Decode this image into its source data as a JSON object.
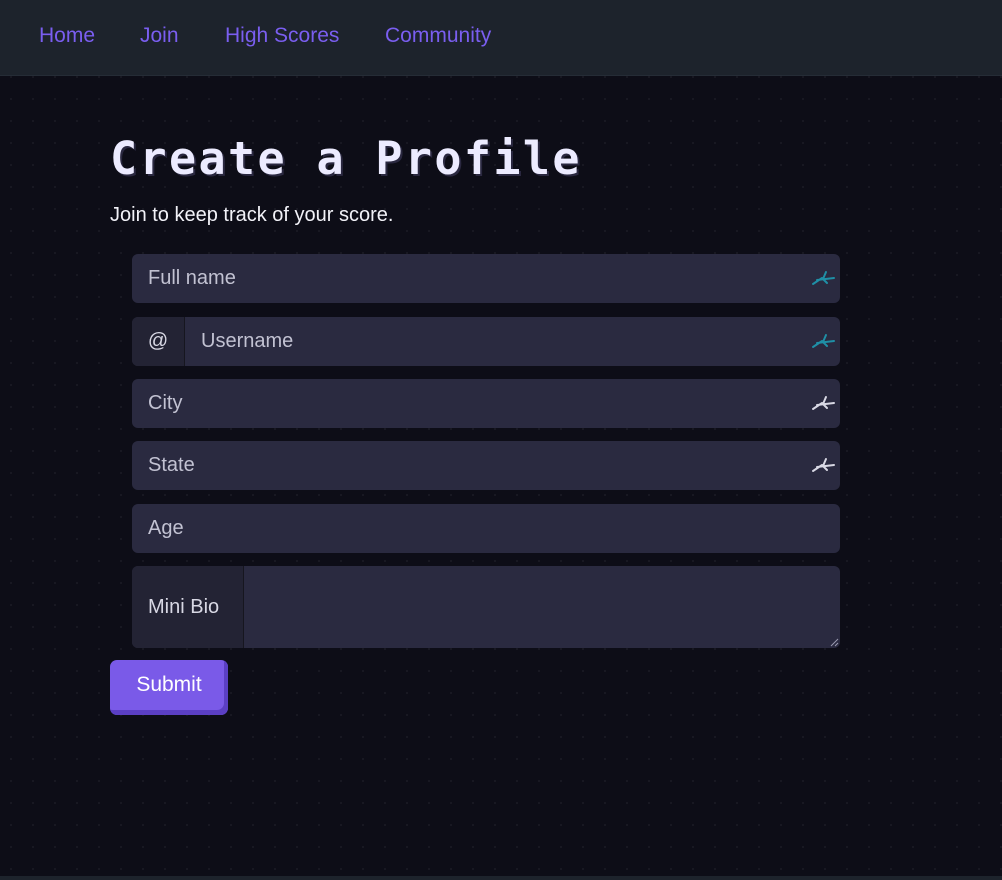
{
  "nav": {
    "home": "Home",
    "join": "Join",
    "high_scores": "High Scores",
    "community": "Community"
  },
  "page": {
    "title": "Create a Profile",
    "subtitle": "Join to keep track of your score."
  },
  "form": {
    "full_name": {
      "placeholder": "Full name",
      "value": "",
      "autofill_icon": "autofill-key-icon"
    },
    "username": {
      "prefix": "@",
      "placeholder": "Username",
      "value": "",
      "autofill_icon": "autofill-key-icon"
    },
    "city": {
      "placeholder": "City",
      "value": "",
      "autofill_icon": "autofill-key-icon"
    },
    "state": {
      "placeholder": "State",
      "value": "",
      "autofill_icon": "autofill-key-icon"
    },
    "age": {
      "placeholder": "Age",
      "value": ""
    },
    "mini_bio": {
      "label": "Mini Bio",
      "value": ""
    },
    "submit_label": "Submit"
  },
  "colors": {
    "accent": "#7a5ae8",
    "nav_link": "#7a5ef0",
    "background": "#0d0d17",
    "navbar": "#1d232c",
    "field": "#2a2a40",
    "autofill_active": "#1f8fa6",
    "autofill_inactive": "#d8d8e4"
  }
}
